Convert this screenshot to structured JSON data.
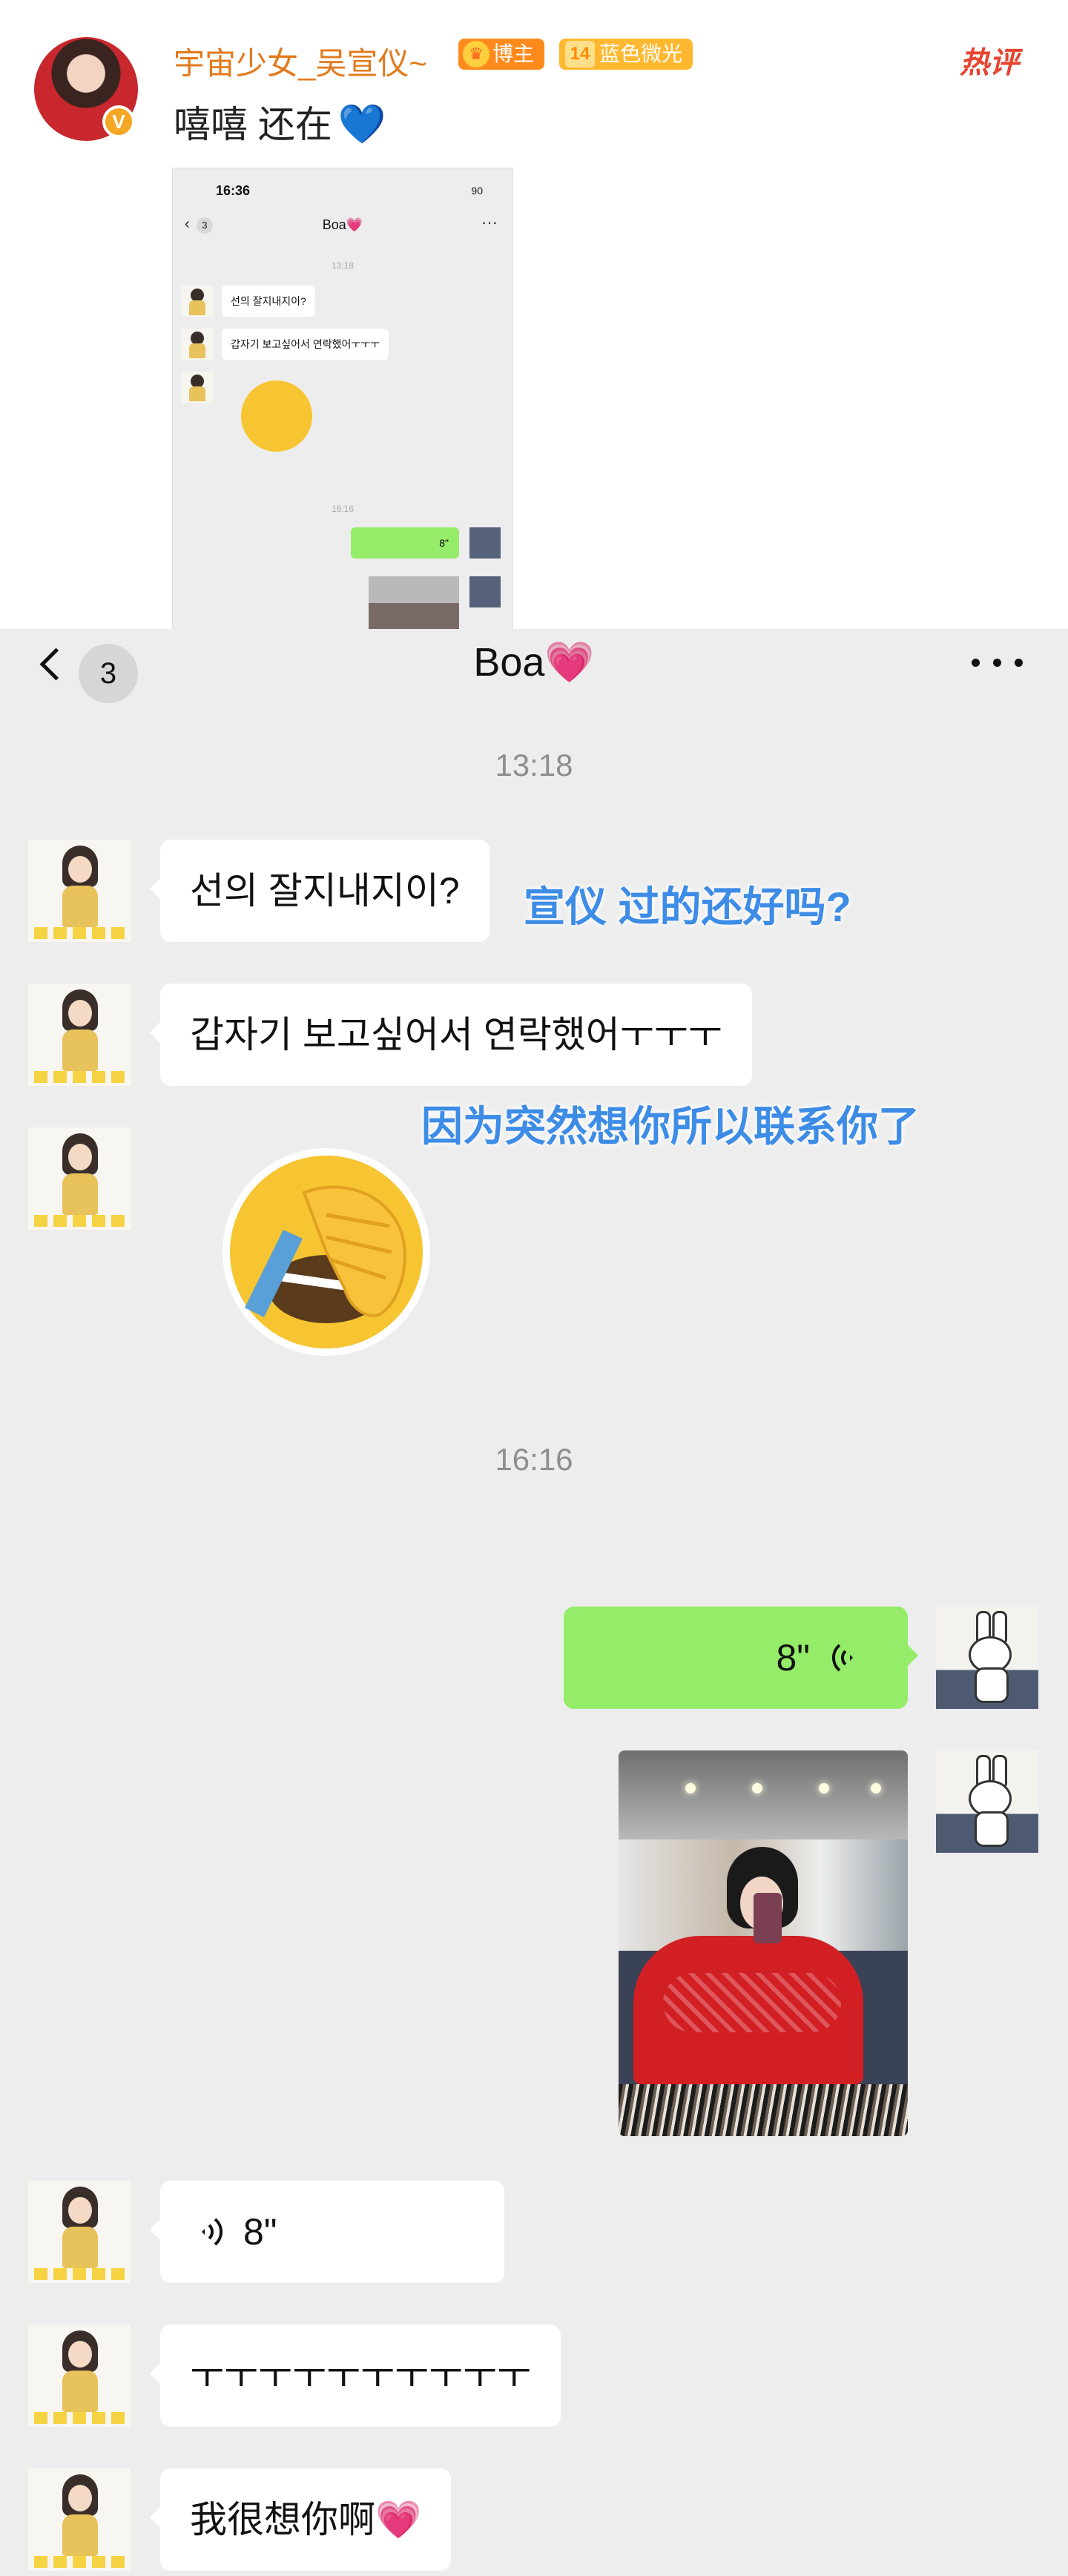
{
  "post": {
    "username": "宇宙少女_吴宣仪~",
    "verified_mark": "V",
    "badge_blogger": "博主",
    "badge_level": "14",
    "badge_membership": "蓝色微光",
    "hot_label": "热评",
    "text": "嘻嘻 还在",
    "text_emoji": "💙"
  },
  "thumbnail": {
    "status_time": "16:36",
    "battery": "90",
    "unread": "3",
    "title": "Boa💗",
    "more": "···",
    "stamp1": "13:18",
    "msg1": "선의 잘지내지이?",
    "msg2": "갑자기 보고싶어서 연락했어ㅜㅜㅜ",
    "stamp2": "16:16",
    "voice": "8\""
  },
  "chat": {
    "unread_count": "3",
    "title": "Boa",
    "title_emoji": "💗",
    "timestamp_1": "13:18",
    "timestamp_2": "16:16",
    "messages": [
      {
        "from": "Boa",
        "type": "text",
        "text": "선의 잘지내지이?"
      },
      {
        "from": "Boa",
        "type": "text",
        "text": "갑자기 보고싶어서 연락했어ㅜㅜㅜ"
      },
      {
        "from": "Boa",
        "type": "sticker",
        "name": "facepalm-emoji"
      },
      {
        "from": "me",
        "type": "voice",
        "duration": "8\""
      },
      {
        "from": "me",
        "type": "photo"
      },
      {
        "from": "Boa",
        "type": "voice",
        "duration": "8\""
      },
      {
        "from": "Boa",
        "type": "text",
        "text": "ㅜㅜㅜㅜㅜㅜㅜㅜㅜㅜ"
      },
      {
        "from": "Boa",
        "type": "text",
        "text": "我很想你啊",
        "emoji": "💗"
      }
    ],
    "captions": {
      "caption_1": "宣仪 过的还好吗?",
      "caption_2": "因为突然想你所以联系你了"
    }
  },
  "colors": {
    "chat_background": "#ededed",
    "my_bubble": "#95ec69",
    "their_bubble": "#ffffff",
    "username": "#e27a1c",
    "caption": "#3d8ce6",
    "hot_label": "#e5442f"
  },
  "icons": [
    "back-icon",
    "more-icon",
    "voice-icon",
    "crown-icon",
    "heart-icon"
  ]
}
